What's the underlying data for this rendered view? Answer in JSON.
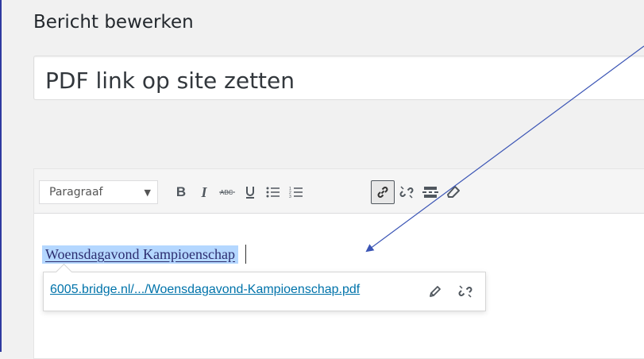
{
  "page": {
    "title": "Bericht bewerken"
  },
  "post": {
    "title_value": "PDF link op site zetten"
  },
  "toolbar": {
    "format_value": "Paragraaf",
    "buttons": [
      {
        "name": "bold-button",
        "icon": "bold-icon"
      },
      {
        "name": "italic-button",
        "icon": "italic-icon"
      },
      {
        "name": "strikethrough-button",
        "icon": "strikethrough-icon"
      },
      {
        "name": "underline-button",
        "icon": "underline-icon"
      },
      {
        "name": "bulleted-list-button",
        "icon": "bulleted-list-icon"
      },
      {
        "name": "numbered-list-button",
        "icon": "numbered-list-icon"
      },
      {
        "name": "insert-link-button",
        "icon": "link-icon",
        "active": true
      },
      {
        "name": "remove-link-button",
        "icon": "unlink-icon"
      },
      {
        "name": "read-more-button",
        "icon": "read-more-icon"
      },
      {
        "name": "clear-formatting-button",
        "icon": "eraser-icon"
      }
    ]
  },
  "content": {
    "link_text": "Woensdagavond Kampioenschap"
  },
  "link_popover": {
    "url_text": "6005.bridge.nl/.../Woensdagavond-Kampioenschap.pdf",
    "edit_icon": "pencil-icon",
    "remove_icon": "unlink-icon"
  },
  "colors": {
    "selection": "#b4d7ff",
    "link": "#0073aa",
    "annotation_arrow": "#3b55b5"
  }
}
